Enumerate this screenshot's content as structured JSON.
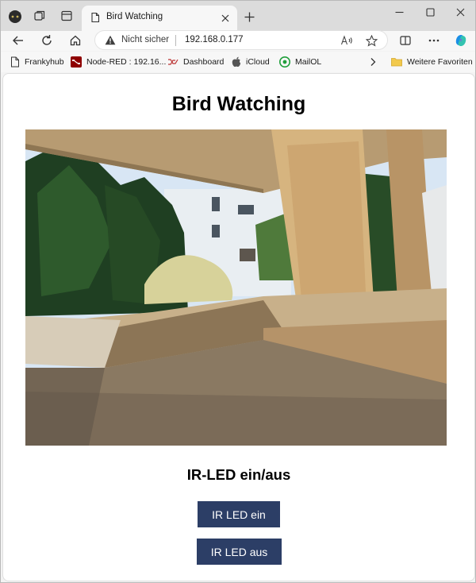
{
  "browser": {
    "tab": {
      "title": "Bird Watching"
    },
    "address": {
      "security_label": "Nicht sicher",
      "url": "192.168.0.177"
    },
    "favorites": [
      {
        "label": "Frankyhub",
        "icon": "page-icon"
      },
      {
        "label": "Node-RED : 192.16...",
        "icon": "node-red-icon"
      },
      {
        "label": "Dashboard",
        "icon": "dashboard-icon"
      },
      {
        "label": "iCloud",
        "icon": "apple-icon"
      },
      {
        "label": "MailOL",
        "icon": "mail-icon"
      }
    ],
    "other_favorites": "Weitere Favoriten"
  },
  "page": {
    "title": "Bird Watching",
    "camera_alt": "Kamerabild",
    "ir_heading": "IR-LED ein/aus",
    "btn_on": "IR LED ein",
    "btn_off": "IR LED aus"
  },
  "colors": {
    "button_bg": "#2c3e66",
    "button_text": "#ffffff"
  }
}
